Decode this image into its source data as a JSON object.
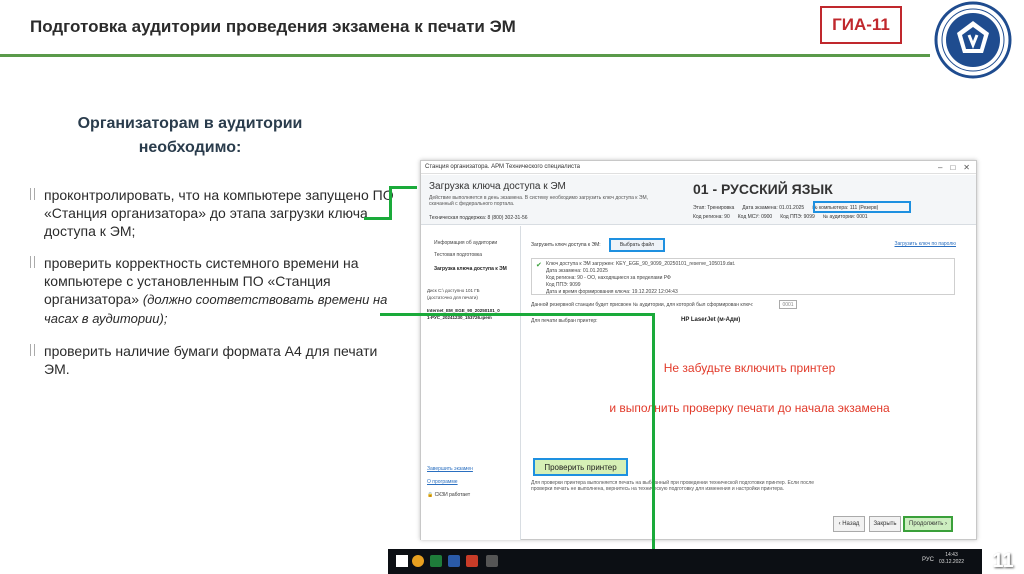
{
  "slide": {
    "title": "Подготовка аудитории проведения экзамена к печати ЭМ",
    "badge": "ГИА-11",
    "page_number": "11",
    "heading": "Организаторам в аудитории необходимо:",
    "bullets": [
      {
        "text": "проконтролировать, что на компьютере запущено ПО «Станция организатора» до этапа загрузки ключа доступа к ЭМ;",
        "note": ""
      },
      {
        "text": "проверить корректность системного времени на компьютере с установленным ПО «Станция организатора»",
        "note": "(должно соответствовать времени на часах в аудитории);"
      },
      {
        "text": "проверить наличие бумаги формата А4 для печати ЭМ.",
        "note": ""
      }
    ],
    "colors": {
      "accent_green": "#1aaa3a",
      "badge_red": "#c0282d",
      "highlight_blue": "#1e90e0",
      "note_red": "#e23a2a"
    }
  },
  "app": {
    "window_title": "Станция организатора. АРМ Технического специалиста",
    "header_title": "Загрузка ключа доступа к ЭМ",
    "header_desc": "Действие выполняется в день экзамена. В систему необходимо загрузить ключ доступа к ЭМ, скачанный с федерального портала.",
    "support": "Техническая поддержка: 8 (800) 302-31-56",
    "subject": "01 - РУССКИЙ ЯЗЫК",
    "meta1": [
      "Этап: Тренировка",
      "Дата экзамена: 01.01.2025",
      "№ компьютера: 111 (Резерв)"
    ],
    "meta2": [
      "Код региона: 90",
      "Код МСУ: 0900",
      "Код ППЭ: 9099",
      "№ аудитории: 0001"
    ],
    "sidebar": {
      "items": [
        "Информация об аудитории",
        "Тестовая подготовка",
        "Загрузка ключа доступа к ЭМ"
      ],
      "disk_info": [
        "Диск С:\\ доступно 101 ГБ",
        "(достаточно для печати)"
      ],
      "file_name": [
        "Internet_EM_EGE_90_20250101_0",
        "1-РУС_20241230_153726.ipem"
      ],
      "end_exam": "Завершить экзамен",
      "about": "О программе",
      "skzi": "СКЗИ работает"
    },
    "content": {
      "load_key_label": "Загрузить ключ доступа к ЭМ:",
      "select_file_btn": "Выбрать файл",
      "backup_link": "Загрузить ключ по паролю",
      "key_loaded": "Ключ доступа к ЭМ загружен: KEY_EGE_90_9099_20250101_reserve_105019.dat.",
      "key_exam_date": "Дата экзамена: 01.01.2025",
      "key_region": "Код региона: 90 - ОО, находящиеся за пределами РФ",
      "key_ppe": "Код ППЭ: 9099",
      "key_created": "Дата и время формирования ключа: 19.12.2022 12:04:43",
      "reserve_text": "Данной резервной станции будет присвоен № аудитории, для которой был сформирован ключ:",
      "reserve_value": "0001",
      "printer_label": "Для печати выбран принтер:",
      "printer_name": "HP LaserJet (м-Адм)",
      "note_line1": "Не забудьте включить принтер",
      "note_line2": "и выполнить проверку печати до начала экзамена",
      "check_btn": "Проверить принтер",
      "check_desc": "Для проверки принтера выполняется печать на выбранный при проведении технической подготовки принтер. Если после проверки печать не выполнена, вернитесь на техническую подготовку для изменения и настройки принтера.",
      "back_btn": "‹ Назад",
      "close_btn": "Закрыть",
      "next_btn": "Продолжить ›"
    }
  },
  "taskbar": {
    "lang": "РУС",
    "time": "14:43",
    "date": "03.12.2022"
  }
}
